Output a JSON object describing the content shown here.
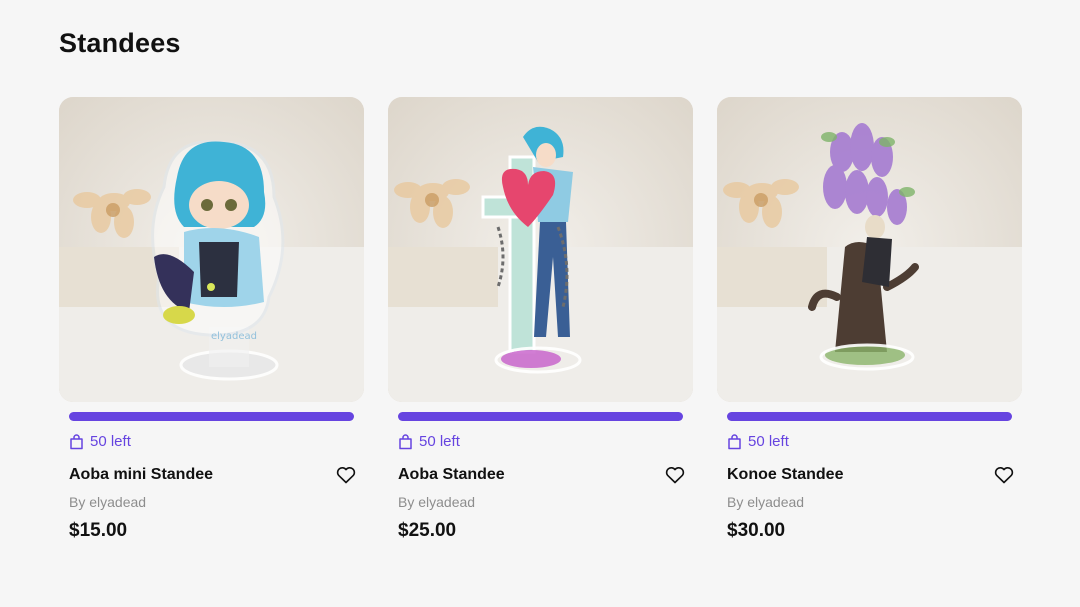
{
  "section": {
    "title": "Standees"
  },
  "colors": {
    "accent": "#6644e0",
    "muted": "#8d8d8d"
  },
  "products": [
    {
      "title": "Aoba mini Standee",
      "stock": "50 left",
      "seller": "By elyadead",
      "price": "$15.00",
      "icons": {
        "stock": "shopping-bag-icon",
        "wishlist": "heart-outline-icon"
      }
    },
    {
      "title": "Aoba Standee",
      "stock": "50 left",
      "seller": "By elyadead",
      "price": "$25.00",
      "icons": {
        "stock": "shopping-bag-icon",
        "wishlist": "heart-outline-icon"
      }
    },
    {
      "title": "Konoe Standee",
      "stock": "50 left",
      "seller": "By elyadead",
      "price": "$30.00",
      "icons": {
        "stock": "shopping-bag-icon",
        "wishlist": "heart-outline-icon"
      }
    }
  ]
}
